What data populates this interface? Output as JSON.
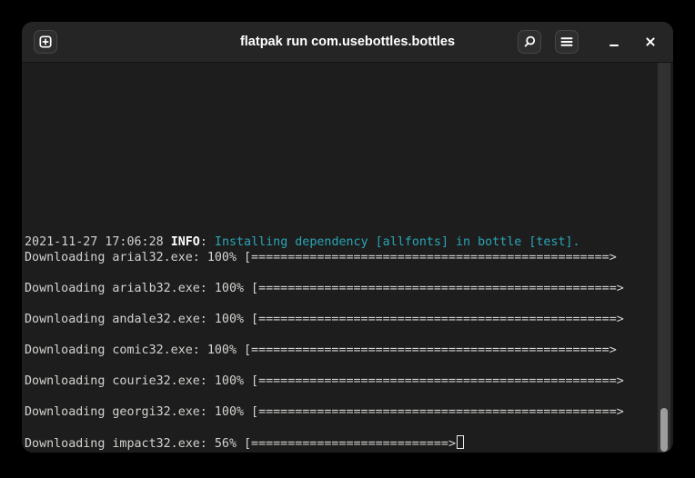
{
  "window": {
    "title": "flatpak run com.usebottles.bottles"
  },
  "colors": {
    "desktop_bg": "#000000",
    "titlebar_bg": "#252525",
    "terminal_bg": "#1d1d1d",
    "terminal_text": "#d3d3d0",
    "terminal_bold_text": "#ffffff",
    "log_message_cyan": "#2aa5b5",
    "scrollbar_thumb": "#9c9c9c"
  },
  "icons": {
    "new_tab": "new-tab-icon",
    "search": "search-icon",
    "menu": "hamburger-menu-icon",
    "minimize": "minimize-icon",
    "close": "close-icon"
  },
  "terminal": {
    "log": {
      "timestamp": "2021-11-27 17:06:28",
      "level": "INFO",
      "colon": ":",
      "message": "Installing dependency [allfonts] in bottle [test]."
    },
    "downloads": [
      {
        "line": "Downloading arial32.exe: 100% [=================================================>"
      },
      {
        "line": "Downloading arialb32.exe: 100% [=================================================>"
      },
      {
        "line": "Downloading andale32.exe: 100% [=================================================>"
      },
      {
        "line": "Downloading comic32.exe: 100% [=================================================>"
      },
      {
        "line": "Downloading courie32.exe: 100% [=================================================>"
      },
      {
        "line": "Downloading georgi32.exe: 100% [=================================================>"
      },
      {
        "line": "Downloading impact32.exe: 56% [===========================>"
      }
    ],
    "cursor_after_last_line": true
  }
}
